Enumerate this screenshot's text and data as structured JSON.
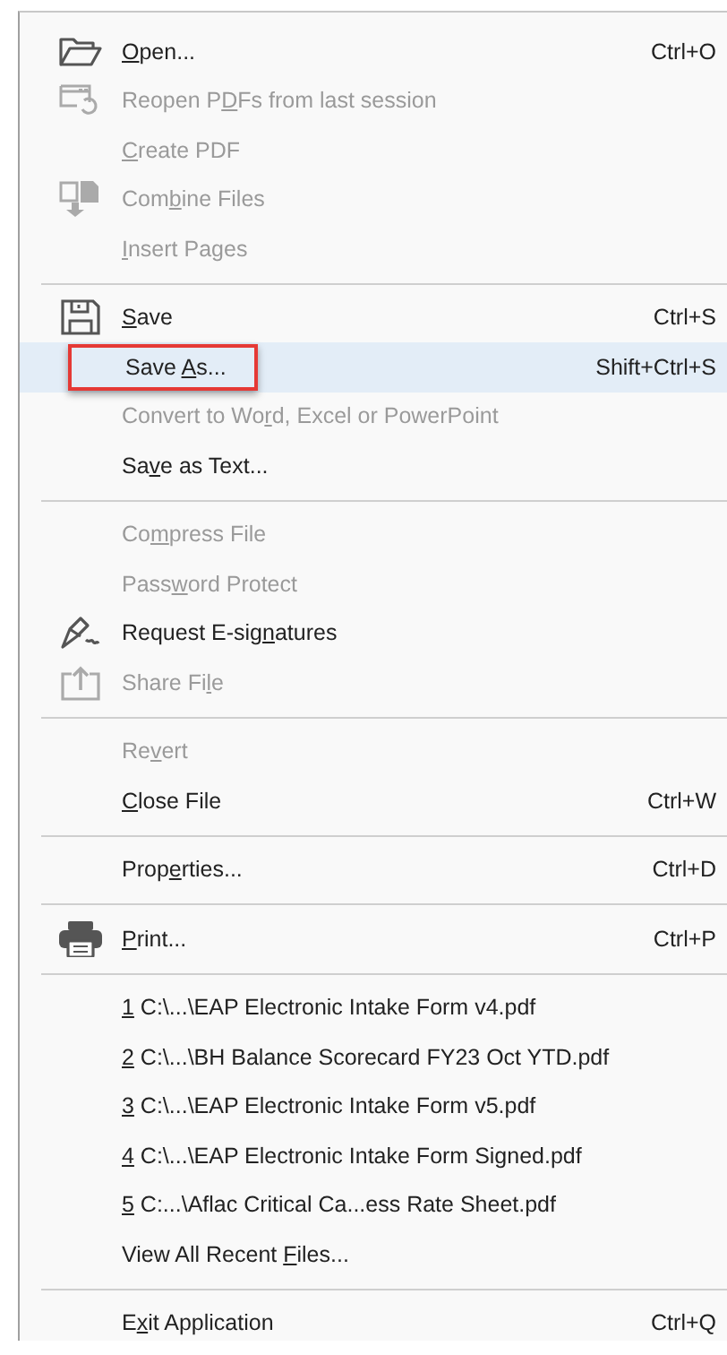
{
  "menu": {
    "groups": [
      {
        "items": [
          {
            "kind": "folder",
            "label": [
              {
                "text": "O",
                "key": true
              },
              {
                "text": "pen...",
                "key": false
              }
            ],
            "shortcut": "Ctrl+O",
            "disabled": false,
            "selected": false
          },
          {
            "kind": "reopen",
            "label": [
              {
                "text": "Reopen P",
                "key": false
              },
              {
                "text": "D",
                "key": true
              },
              {
                "text": "Fs from last session",
                "key": false
              }
            ],
            "disabled": true,
            "selected": false
          },
          {
            "label": [
              {
                "text": "C",
                "key": true
              },
              {
                "text": "reate PDF",
                "key": false
              }
            ],
            "disabled": true,
            "selected": false
          },
          {
            "kind": "combine",
            "label": [
              {
                "text": "Com",
                "key": false
              },
              {
                "text": "b",
                "key": true
              },
              {
                "text": "ine Files",
                "key": false
              }
            ],
            "disabled": true,
            "selected": false
          },
          {
            "label": [
              {
                "text": "I",
                "key": true
              },
              {
                "text": "nsert Pages",
                "key": false
              }
            ],
            "disabled": true,
            "selected": false
          }
        ]
      },
      {
        "items": [
          {
            "kind": "save",
            "label": [
              {
                "text": "S",
                "key": true
              },
              {
                "text": "ave",
                "key": false
              }
            ],
            "shortcut": "Ctrl+S",
            "disabled": false,
            "selected": false
          },
          {
            "label": [
              {
                "text": "Save ",
                "key": false
              },
              {
                "text": "A",
                "key": true
              },
              {
                "text": "s...",
                "key": false
              }
            ],
            "shortcut": "Shift+Ctrl+S",
            "disabled": false,
            "selected": true,
            "callout": true
          },
          {
            "label": [
              {
                "text": "Convert to Wo",
                "key": false
              },
              {
                "text": "r",
                "key": true
              },
              {
                "text": "d, Excel or PowerPoint",
                "key": false
              }
            ],
            "disabled": true,
            "selected": false
          },
          {
            "label": [
              {
                "text": "Sa",
                "key": false
              },
              {
                "text": "v",
                "key": true
              },
              {
                "text": "e as Text...",
                "key": false
              }
            ],
            "disabled": false,
            "selected": false
          }
        ]
      },
      {
        "items": [
          {
            "label": [
              {
                "text": "Co",
                "key": false
              },
              {
                "text": "m",
                "key": true
              },
              {
                "text": "press File",
                "key": false
              }
            ],
            "disabled": true,
            "selected": false
          },
          {
            "label": [
              {
                "text": "Pass",
                "key": false
              },
              {
                "text": "w",
                "key": true
              },
              {
                "text": "ord Protect",
                "key": false
              }
            ],
            "disabled": true,
            "selected": false
          },
          {
            "kind": "sign",
            "label": [
              {
                "text": "Request E-sig",
                "key": false
              },
              {
                "text": "n",
                "key": true
              },
              {
                "text": "atures",
                "key": false
              }
            ],
            "disabled": false,
            "selected": false
          },
          {
            "kind": "share",
            "label": [
              {
                "text": "Share Fi",
                "key": false
              },
              {
                "text": "l",
                "key": true
              },
              {
                "text": "e",
                "key": false
              }
            ],
            "disabled": true,
            "selected": false
          }
        ]
      },
      {
        "items": [
          {
            "label": [
              {
                "text": "Re",
                "key": false
              },
              {
                "text": "v",
                "key": true
              },
              {
                "text": "ert",
                "key": false
              }
            ],
            "disabled": true,
            "selected": false
          },
          {
            "label": [
              {
                "text": "C",
                "key": true
              },
              {
                "text": "lose File",
                "key": false
              }
            ],
            "shortcut": "Ctrl+W",
            "disabled": false,
            "selected": false
          }
        ]
      },
      {
        "items": [
          {
            "label": [
              {
                "text": "Prop",
                "key": false
              },
              {
                "text": "e",
                "key": true
              },
              {
                "text": "rties...",
                "key": false
              }
            ],
            "shortcut": "Ctrl+D",
            "disabled": false,
            "selected": false
          }
        ]
      },
      {
        "items": [
          {
            "kind": "print",
            "label": [
              {
                "text": "P",
                "key": true
              },
              {
                "text": "rint...",
                "key": false
              }
            ],
            "shortcut": "Ctrl+P",
            "disabled": false,
            "selected": false
          }
        ]
      },
      {
        "items": [
          {
            "label": [
              {
                "text": "1",
                "key": true
              },
              {
                "text": " C:\\...\\EAP Electronic Intake Form v4.pdf",
                "key": false
              }
            ],
            "disabled": false,
            "selected": false
          },
          {
            "label": [
              {
                "text": "2",
                "key": true
              },
              {
                "text": " C:\\...\\BH Balance Scorecard FY23 Oct YTD.pdf",
                "key": false
              }
            ],
            "disabled": false,
            "selected": false
          },
          {
            "label": [
              {
                "text": "3",
                "key": true
              },
              {
                "text": " C:\\...\\EAP Electronic Intake Form v5.pdf",
                "key": false
              }
            ],
            "disabled": false,
            "selected": false
          },
          {
            "label": [
              {
                "text": "4",
                "key": true
              },
              {
                "text": " C:\\...\\EAP Electronic Intake Form Signed.pdf",
                "key": false
              }
            ],
            "disabled": false,
            "selected": false
          },
          {
            "label": [
              {
                "text": "5",
                "key": true
              },
              {
                "text": " C:...\\Aflac Critical Ca...ess Rate Sheet.pdf",
                "key": false
              }
            ],
            "disabled": false,
            "selected": false
          },
          {
            "label": [
              {
                "text": "View All Recent ",
                "key": false
              },
              {
                "text": "F",
                "key": true
              },
              {
                "text": "iles...",
                "key": false
              }
            ],
            "disabled": false,
            "selected": false
          }
        ]
      },
      {
        "items": [
          {
            "label": [
              {
                "text": "E",
                "key": false
              },
              {
                "text": "x",
                "key": true
              },
              {
                "text": "it Application",
                "key": false
              }
            ],
            "shortcut": "Ctrl+Q",
            "disabled": false,
            "selected": false
          }
        ]
      }
    ]
  }
}
